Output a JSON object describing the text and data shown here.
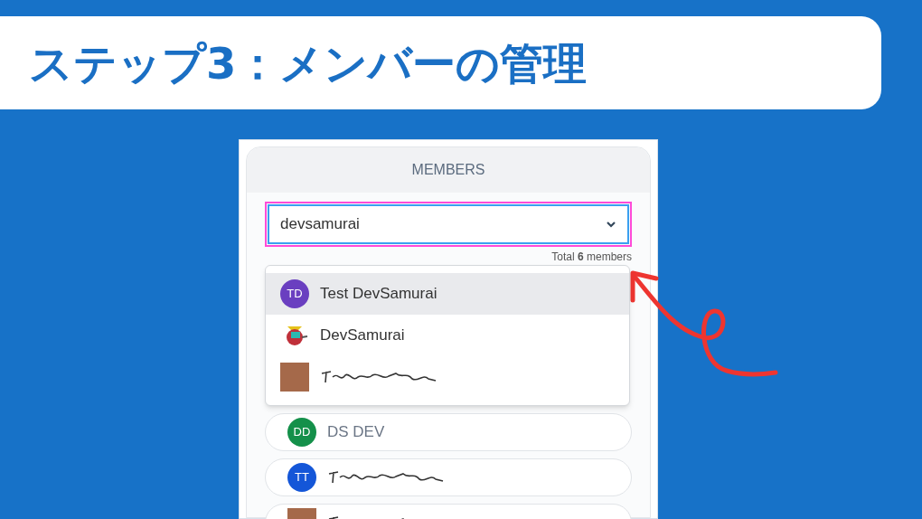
{
  "title": "ステップ3：メンバーの管理",
  "panel": {
    "header": "MEMBERS",
    "search": {
      "value": "devsamurai"
    },
    "total": "Total **6** members",
    "options": [
      {
        "kind": "initials",
        "initials": "TD",
        "color": "#6a3fc0",
        "name": "Test DevSamurai",
        "selected": true
      },
      {
        "kind": "logo",
        "name": "DevSamurai",
        "selected": false
      },
      {
        "kind": "photo",
        "selected": false
      }
    ],
    "members": [
      {
        "kind": "initials",
        "initials": "DD",
        "color": "#14904a",
        "name": "DS DEV"
      },
      {
        "kind": "initials",
        "initials": "TT",
        "color": "#1456d8"
      },
      {
        "kind": "photo"
      }
    ]
  }
}
